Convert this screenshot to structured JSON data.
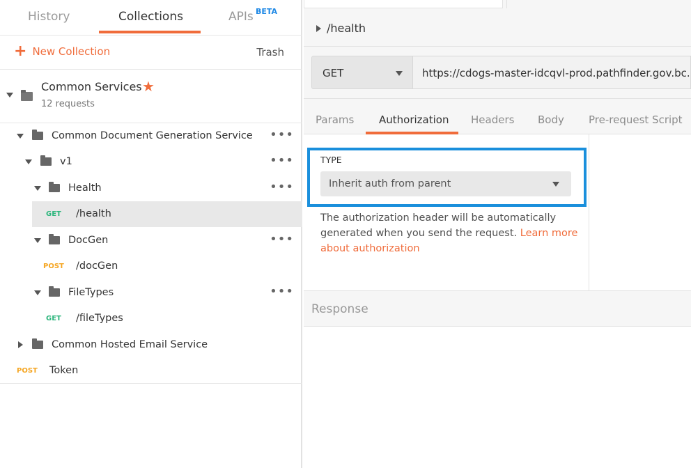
{
  "sidebar": {
    "tabs": {
      "history": "History",
      "collections": "Collections",
      "apis": "APIs",
      "apis_badge": "BETA"
    },
    "new_collection": "New Collection",
    "trash": "Trash",
    "collection": {
      "name": "Common Services",
      "count": "12 requests"
    },
    "tree": {
      "cdgs": "Common Document Generation Service",
      "v1": "v1",
      "health": "Health",
      "health_req": "/health",
      "docgen": "DocGen",
      "docgen_req": "/docGen",
      "filetypes": "FileTypes",
      "filetypes_req": "/fileTypes",
      "ches": "Common Hosted Email Service",
      "token": "Token"
    },
    "methods": {
      "get": "GET",
      "post": "POST"
    }
  },
  "request": {
    "name": "/health",
    "method": "GET",
    "url": "https://cdogs-master-idcqvl-prod.pathfinder.gov.bc.ca/a"
  },
  "request_tabs": {
    "params": "Params",
    "authorization": "Authorization",
    "headers": "Headers",
    "body": "Body",
    "prerequest": "Pre-request Script"
  },
  "auth": {
    "type_label": "TYPE",
    "type_value": "Inherit auth from parent",
    "description": "The authorization header will be automatically generated when you send the request. ",
    "learn_more": "Learn more about authorization"
  },
  "response": {
    "label": "Response"
  },
  "colors": {
    "accent": "#f06c3b",
    "highlight": "#1a8fdc",
    "get": "#2eb67d",
    "post": "#f5a623"
  }
}
